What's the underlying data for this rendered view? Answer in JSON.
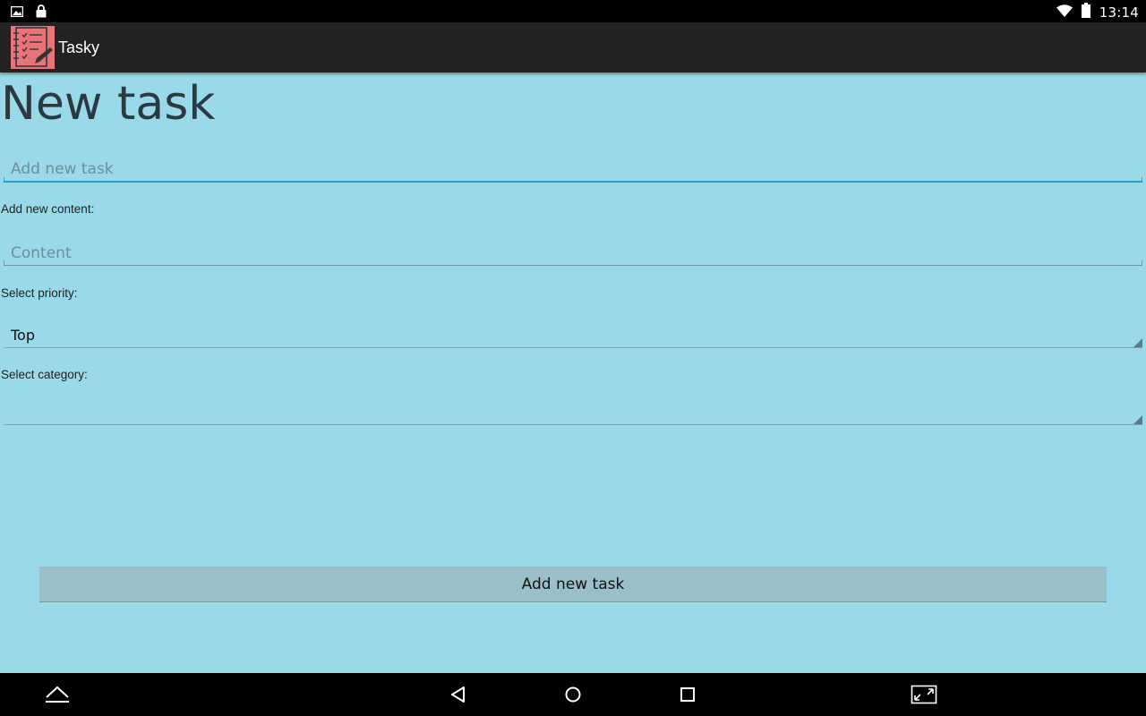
{
  "status_bar": {
    "time": "13:14",
    "left_icons": [
      "image-icon",
      "lock-icon"
    ],
    "right_icons": [
      "wifi-icon",
      "battery-icon"
    ]
  },
  "action_bar": {
    "title": "Tasky",
    "icon": "checklist-notebook-icon",
    "icon_color": "#e8747a"
  },
  "page": {
    "heading": "New task"
  },
  "form": {
    "task_placeholder": "Add new task",
    "content_label": "Add new content:",
    "content_placeholder": "Content",
    "priority_label": "Select priority:",
    "priority_value": "Top",
    "category_label": "Select category:",
    "category_value": "",
    "submit_label": "Add new task"
  },
  "nav_bar": {
    "buttons": [
      "expand-up-icon",
      "back-icon",
      "home-icon",
      "recents-icon",
      "screen-resize-icon"
    ]
  },
  "colors": {
    "background": "#99d9e8",
    "accent": "#2a9fca",
    "button": "#9bbfc8"
  }
}
